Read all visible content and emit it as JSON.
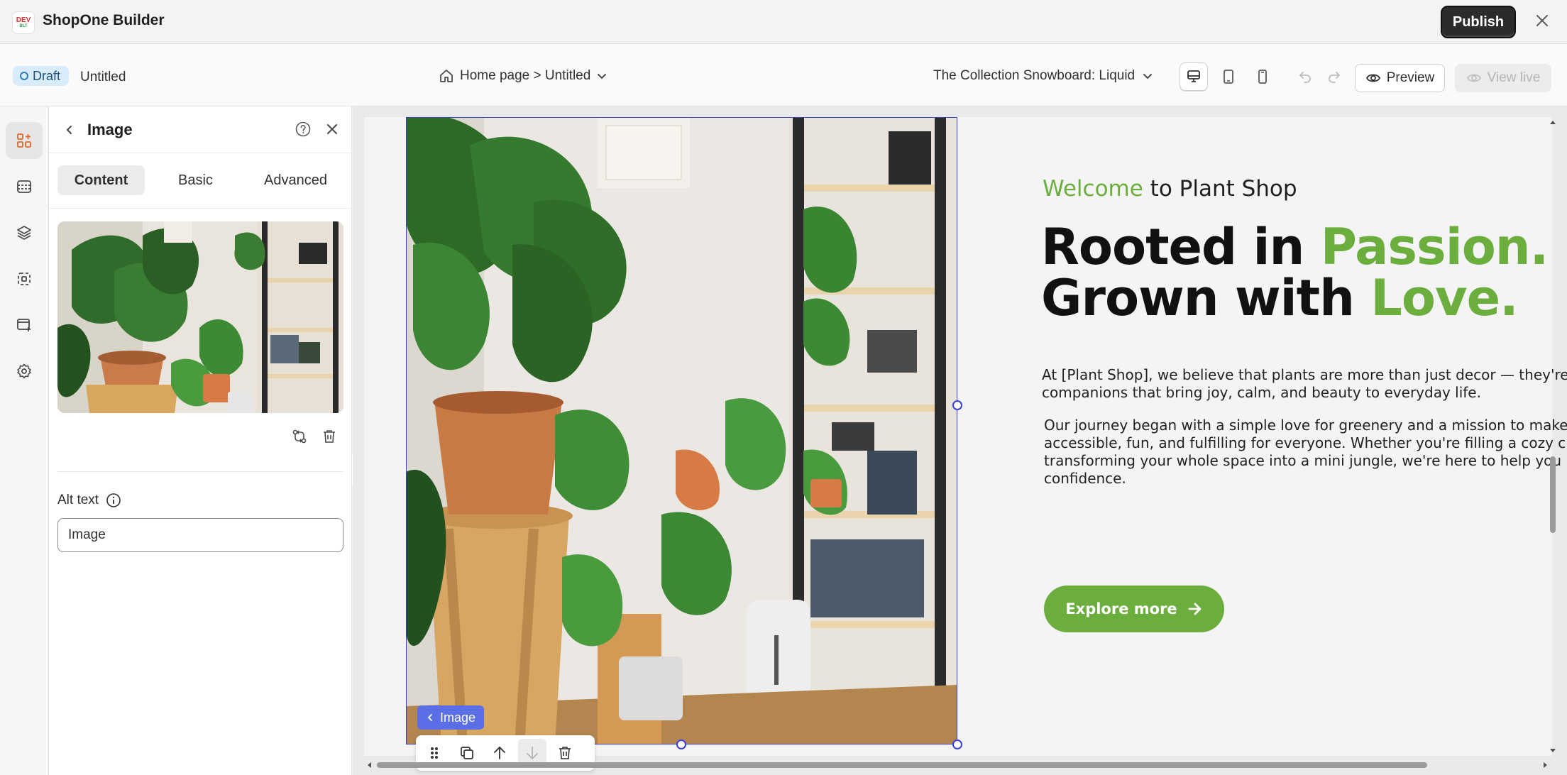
{
  "app": {
    "title": "ShopOne Builder",
    "logo_top": "DEV",
    "logo_bottom": "BLT",
    "publish_label": "Publish"
  },
  "subbar": {
    "status": "Draft",
    "page_name": "Untitled",
    "breadcrumb": "Home page > Untitled",
    "template": "The Collection Snowboard: Liquid",
    "preview_label": "Preview",
    "view_live_label": "View live"
  },
  "panel": {
    "title": "Image",
    "tabs": [
      {
        "label": "Content",
        "active": true
      },
      {
        "label": "Basic",
        "active": false
      },
      {
        "label": "Advanced",
        "active": false
      }
    ],
    "alt_label": "Alt text",
    "alt_value": "Image"
  },
  "canvas": {
    "element_tag": "Image",
    "welcome_green": "Welcome",
    "welcome_rest": " to Plant Shop",
    "headline_line1_a": "Rooted in ",
    "headline_line1_b": "Passion.",
    "headline_line2_a": "Grown with ",
    "headline_line2_b": "Love.",
    "para1_line1": "At [Plant Shop], we believe that plants are more than just decor — they're",
    "para1_line2": "companions that bring joy, calm, and beauty to everyday life.",
    "para2_line1": "Our journey began with a simple love for greenery and a mission to make",
    "para2_line2": "accessible, fun, and fulfilling for everyone. Whether you're filling a cozy c",
    "para2_line3": "transforming your whole space into a mini jungle, we're here to help you",
    "para2_line4": "confidence.",
    "button_label": "Explore more"
  },
  "colors": {
    "accent_green": "#6cae3e",
    "selection_blue": "#3a3fdc",
    "publish_bg": "#2b2b2b",
    "draft_bg": "#d9ecfb"
  }
}
